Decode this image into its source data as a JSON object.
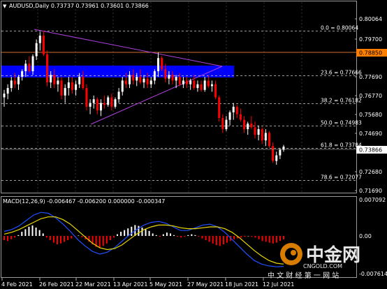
{
  "header": {
    "symbol_line": "AUDUSD,Daily  0.73737 0.73961 0.73601 0.73866"
  },
  "colors": {
    "bull": "#ffffff",
    "bear": "#ff0000",
    "grid": "#8a8a8a",
    "trend": "#b040e0",
    "zone": "#0000ff",
    "fib_top": "#c06030",
    "price_box": "#ff7f00",
    "signal": "#e8d800",
    "macd_line": "#2050ff",
    "macd_pos": "#ffffff",
    "macd_neg": "#ff0000"
  },
  "price_axis": [
    "0.80064",
    "0.79700",
    "0.78850",
    "0.77690",
    "0.76770",
    "0.75680",
    "0.74690",
    "0.73866",
    "0.72680",
    "0.71690"
  ],
  "current_price_badge": "0.73866",
  "highlighted_level": "0.78850",
  "fib_levels": [
    {
      "label": "0.0 = 0.80064",
      "value": 0.80064
    },
    {
      "label": "23.6 = 0.77666",
      "value": 0.77666
    },
    {
      "label": "38.2 = 0.76182",
      "value": 0.76182
    },
    {
      "label": "50.0 = 0.74983",
      "value": 0.74983
    },
    {
      "label": "61.8 = 0.73784",
      "value": 0.73784
    },
    {
      "label": "78.6 = 0.72077",
      "value": 0.72077
    }
  ],
  "macd": {
    "label": "MACD(12,26,9) -0.006467 -0.006200 0.000000 -0.000347",
    "axis": [
      "0.007092",
      "0.00",
      "-0.007614"
    ]
  },
  "date_axis": [
    "4 Feb 2021",
    "26 Feb 2021",
    "22 Mar 2021",
    "13 Apr 2021",
    "5 May 2021",
    "27 May 2021",
    "18 Jun 2021",
    "12 Jul 2021"
  ],
  "watermark": {
    "brand": "中金网",
    "domain": "CNGOLD.COM",
    "tagline": "中 文 财 经 第 一 网 站"
  }
}
